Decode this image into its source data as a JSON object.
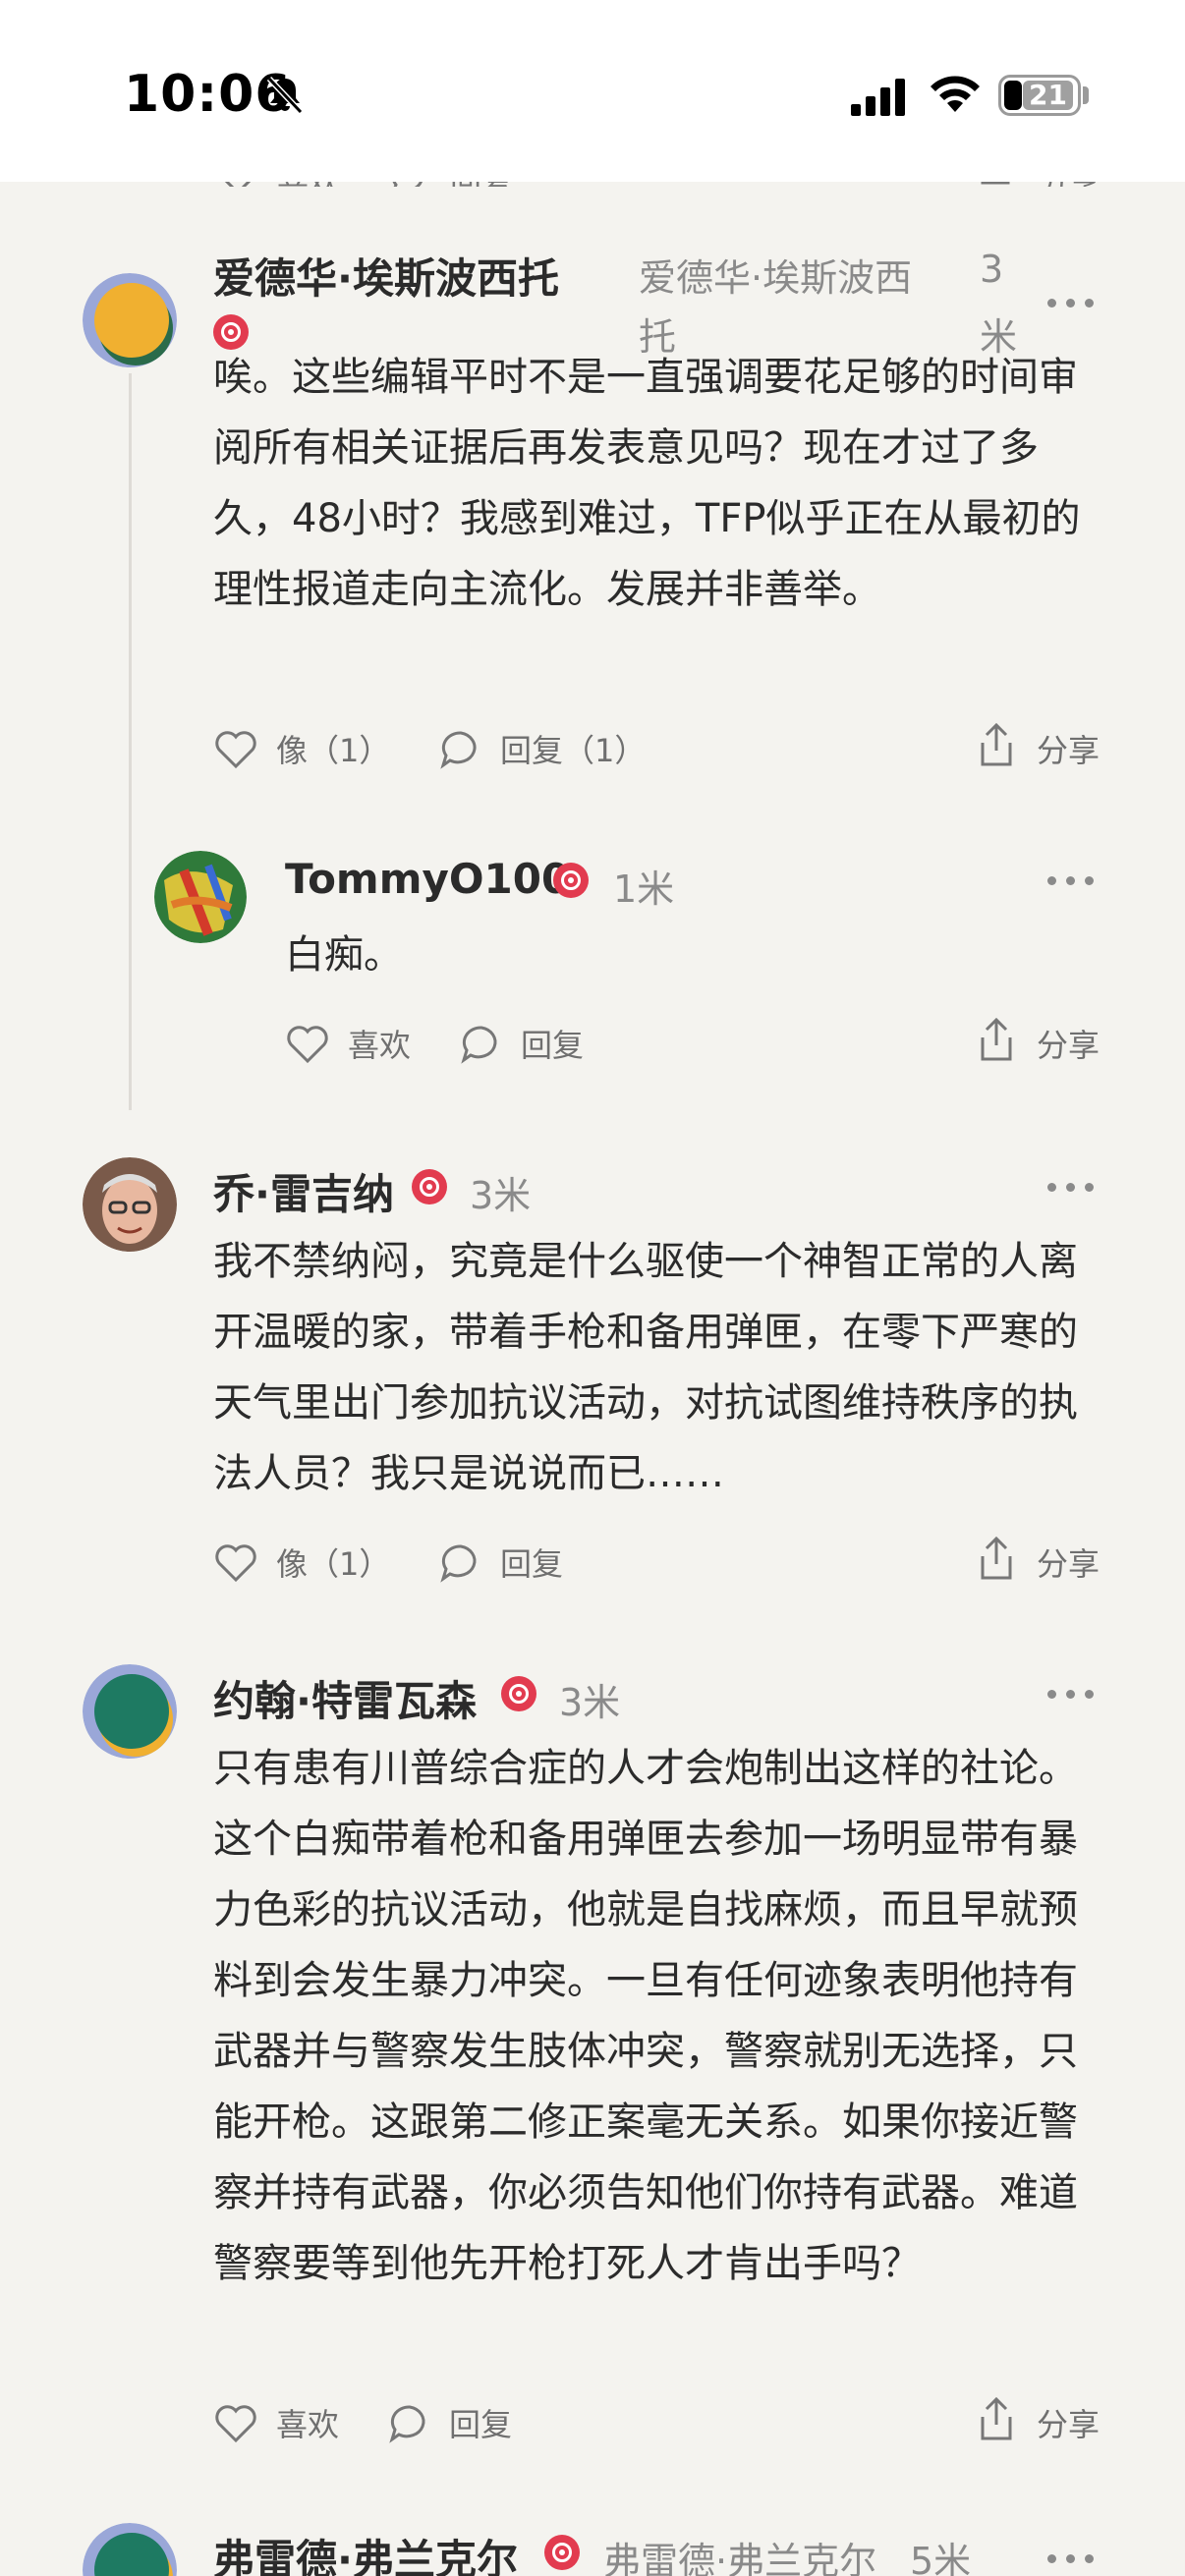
{
  "status_bar": {
    "time": "10:06",
    "battery": "21"
  },
  "partial_actions": {
    "like": "喜欢",
    "reply": "回复",
    "share": "分享"
  },
  "comments": [
    {
      "author": "爱德华·埃斯波西托",
      "author_repeat_1": "爱德华·埃斯波西",
      "author_repeat_2": "托",
      "time_1": "3",
      "time_2": "米",
      "text": "唉。这些编辑平时不是一直强调要花足够的时间审阅所有相关证据后再发表意见吗？现在才过了多久，48小时？我感到难过，TFP似乎正在从最初的理性报道走向主流化。发展并非善举。",
      "like_label": "像（1）",
      "reply_label": "回复（1）",
      "share_label": "分享",
      "avatar_colors": [
        "#f0b030",
        "#2a6b4a"
      ]
    },
    {
      "author": "TommyO100",
      "time": "1米",
      "text": "白痴。",
      "like_label": "喜欢",
      "reply_label": "回复",
      "share_label": "分享"
    },
    {
      "author": "乔·雷吉纳",
      "time": "3米",
      "text": "我不禁纳闷，究竟是什么驱使一个神智正常的人离开温暖的家，带着手枪和备用弹匣，在零下严寒的天气里出门参加抗议活动，对抗试图维持秩序的执法人员？我只是说说而已……",
      "like_label": "像（1）",
      "reply_label": "回复",
      "share_label": "分享"
    },
    {
      "author": "约翰·特雷瓦森",
      "time": "3米",
      "text": "只有患有川普综合症的人才会炮制出这样的社论。这个白痴带着枪和备用弹匣去参加一场明显带有暴力色彩的抗议活动，他就是自找麻烦，而且早就预料到会发生暴力冲突。一旦有任何迹象表明他持有武器并与警察发生肢体冲突，警察就别无选择，只能开枪。这跟第二修正案毫无关系。如果你接近警察并持有武器，你必须告知他们你持有武器。难道警察要等到他先开枪打死人才肯出手吗？",
      "like_label": "喜欢",
      "reply_label": "回复",
      "share_label": "分享",
      "avatar_colors": [
        "#1e7a62",
        "#f0b030"
      ]
    },
    {
      "author": "弗雷德·弗兰克尔",
      "author_repeat": "弗雷德·弗兰克尔",
      "time": "5米"
    }
  ]
}
